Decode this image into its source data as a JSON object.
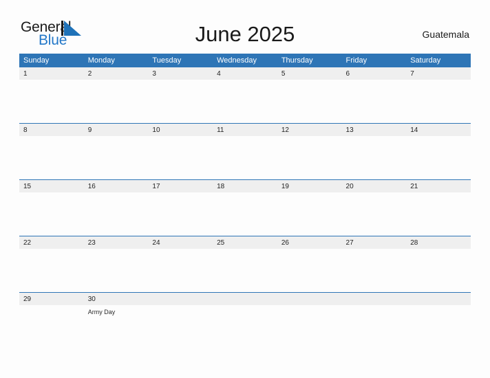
{
  "brand": {
    "name_part1": "General",
    "name_part2": "Blue",
    "logo_icon": "blue-triangle-logo",
    "accent_color": "#2277c8"
  },
  "header": {
    "title": "June 2025",
    "country": "Guatemala"
  },
  "colors": {
    "header_blue": "#2e75b6",
    "daynum_band": "#efefef",
    "page_background": "#fdfdfd",
    "text": "#1a1a1a"
  },
  "calendar": {
    "month": "June",
    "year": "2025",
    "weekday_headers": [
      "Sunday",
      "Monday",
      "Tuesday",
      "Wednesday",
      "Thursday",
      "Friday",
      "Saturday"
    ],
    "weeks": [
      [
        {
          "day": "1",
          "event": ""
        },
        {
          "day": "2",
          "event": ""
        },
        {
          "day": "3",
          "event": ""
        },
        {
          "day": "4",
          "event": ""
        },
        {
          "day": "5",
          "event": ""
        },
        {
          "day": "6",
          "event": ""
        },
        {
          "day": "7",
          "event": ""
        }
      ],
      [
        {
          "day": "8",
          "event": ""
        },
        {
          "day": "9",
          "event": ""
        },
        {
          "day": "10",
          "event": ""
        },
        {
          "day": "11",
          "event": ""
        },
        {
          "day": "12",
          "event": ""
        },
        {
          "day": "13",
          "event": ""
        },
        {
          "day": "14",
          "event": ""
        }
      ],
      [
        {
          "day": "15",
          "event": ""
        },
        {
          "day": "16",
          "event": ""
        },
        {
          "day": "17",
          "event": ""
        },
        {
          "day": "18",
          "event": ""
        },
        {
          "day": "19",
          "event": ""
        },
        {
          "day": "20",
          "event": ""
        },
        {
          "day": "21",
          "event": ""
        }
      ],
      [
        {
          "day": "22",
          "event": ""
        },
        {
          "day": "23",
          "event": ""
        },
        {
          "day": "24",
          "event": ""
        },
        {
          "day": "25",
          "event": ""
        },
        {
          "day": "26",
          "event": ""
        },
        {
          "day": "27",
          "event": ""
        },
        {
          "day": "28",
          "event": ""
        }
      ],
      [
        {
          "day": "29",
          "event": ""
        },
        {
          "day": "30",
          "event": "Army Day"
        },
        {
          "day": "",
          "event": ""
        },
        {
          "day": "",
          "event": ""
        },
        {
          "day": "",
          "event": ""
        },
        {
          "day": "",
          "event": ""
        },
        {
          "day": "",
          "event": ""
        }
      ]
    ]
  }
}
